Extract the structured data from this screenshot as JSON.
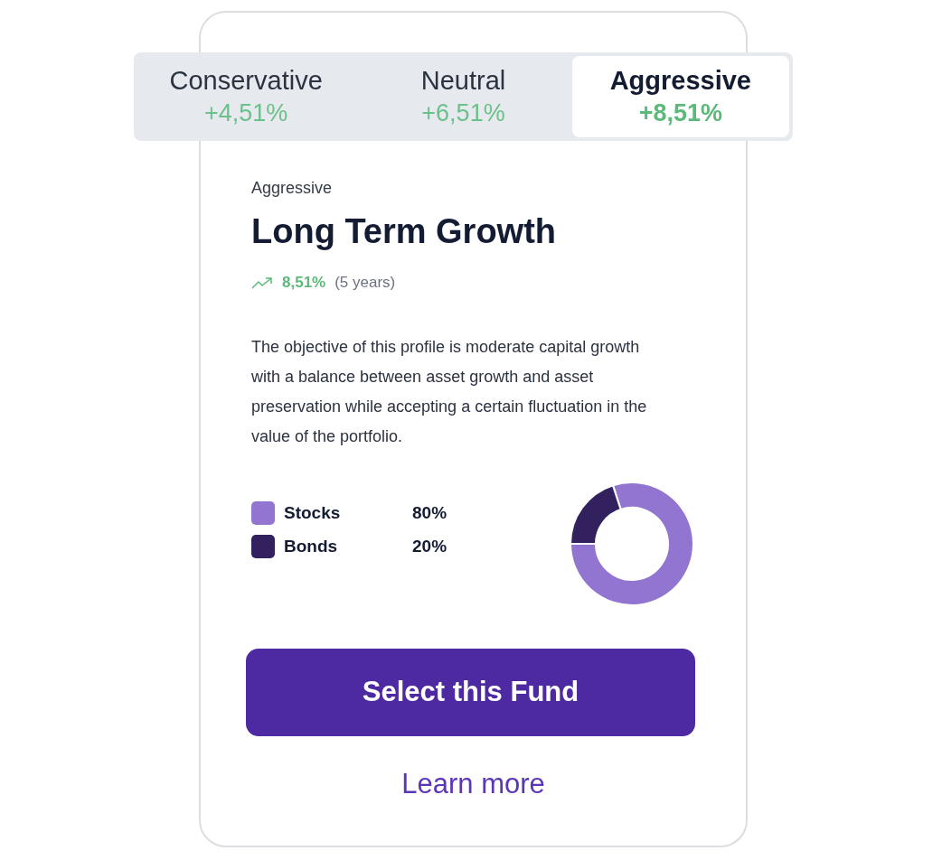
{
  "tabs": [
    {
      "label": "Conservative",
      "value": "+4,51%",
      "selected": false
    },
    {
      "label": "Neutral",
      "value": "+6,51%",
      "selected": false
    },
    {
      "label": "Aggressive",
      "value": "+8,51%",
      "selected": true
    }
  ],
  "profile": {
    "category": "Aggressive",
    "title": "Long Term Growth",
    "return": "8,51%",
    "period": "(5 years)",
    "description": "The objective of this profile is moderate capital growth with a balance between asset growth and asset preservation while accepting a certain fluctuation in the value of the portfolio."
  },
  "allocation": [
    {
      "share": "80%",
      "color": "#9175d1"
    },
    {
      "share": "20%",
      "color": "#33205f"
    }
  ],
  "chart_data": {
    "type": "donut",
    "categories": [
      "Stocks",
      "Bonds"
    ],
    "values": [
      80,
      20
    ]
  },
  "primary_button": "Select this Fund",
  "secondary_link": "Learn more"
}
